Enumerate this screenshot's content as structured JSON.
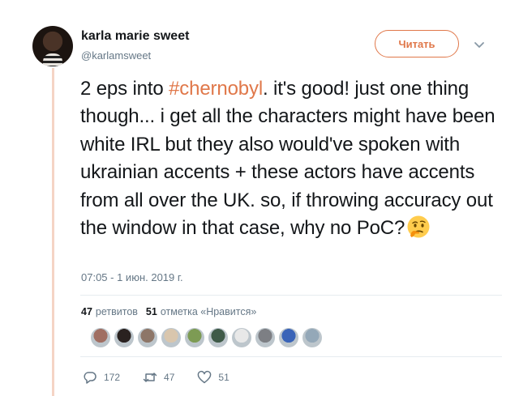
{
  "tweet": {
    "author": {
      "name": "karla marie sweet",
      "handle": "@karlamsweet"
    },
    "follow_label": "Читать",
    "text_before": "2 eps into ",
    "hashtag": "#chernobyl",
    "text_after": ". it's good! just one thing though... i get all the characters might have been white IRL but they also would've spoken with ukrainian accents + these actors have accents from all over the UK. so, if throwing accuracy out the window in that case, why no PoC?",
    "emoji": "thinking-face",
    "timestamp": "07:05 - 1 июн. 2019 г.",
    "stats": {
      "retweets_count": "47",
      "retweets_label": "ретвитов",
      "likes_count": "51",
      "likes_label": "отметка «Нравится»"
    },
    "likers": [
      "#a06f63",
      "#2a2220",
      "#8d7668",
      "#d9c6ad",
      "#7d9b54",
      "#3f5a48",
      "#e8e8e8",
      "#7d7f84",
      "#3a64b8",
      "#94a8b8"
    ],
    "actions": {
      "replies": "172",
      "retweets": "47",
      "likes": "51"
    },
    "colors": {
      "accent": "#e0784a",
      "thread_line": "#f5d4c5"
    }
  }
}
